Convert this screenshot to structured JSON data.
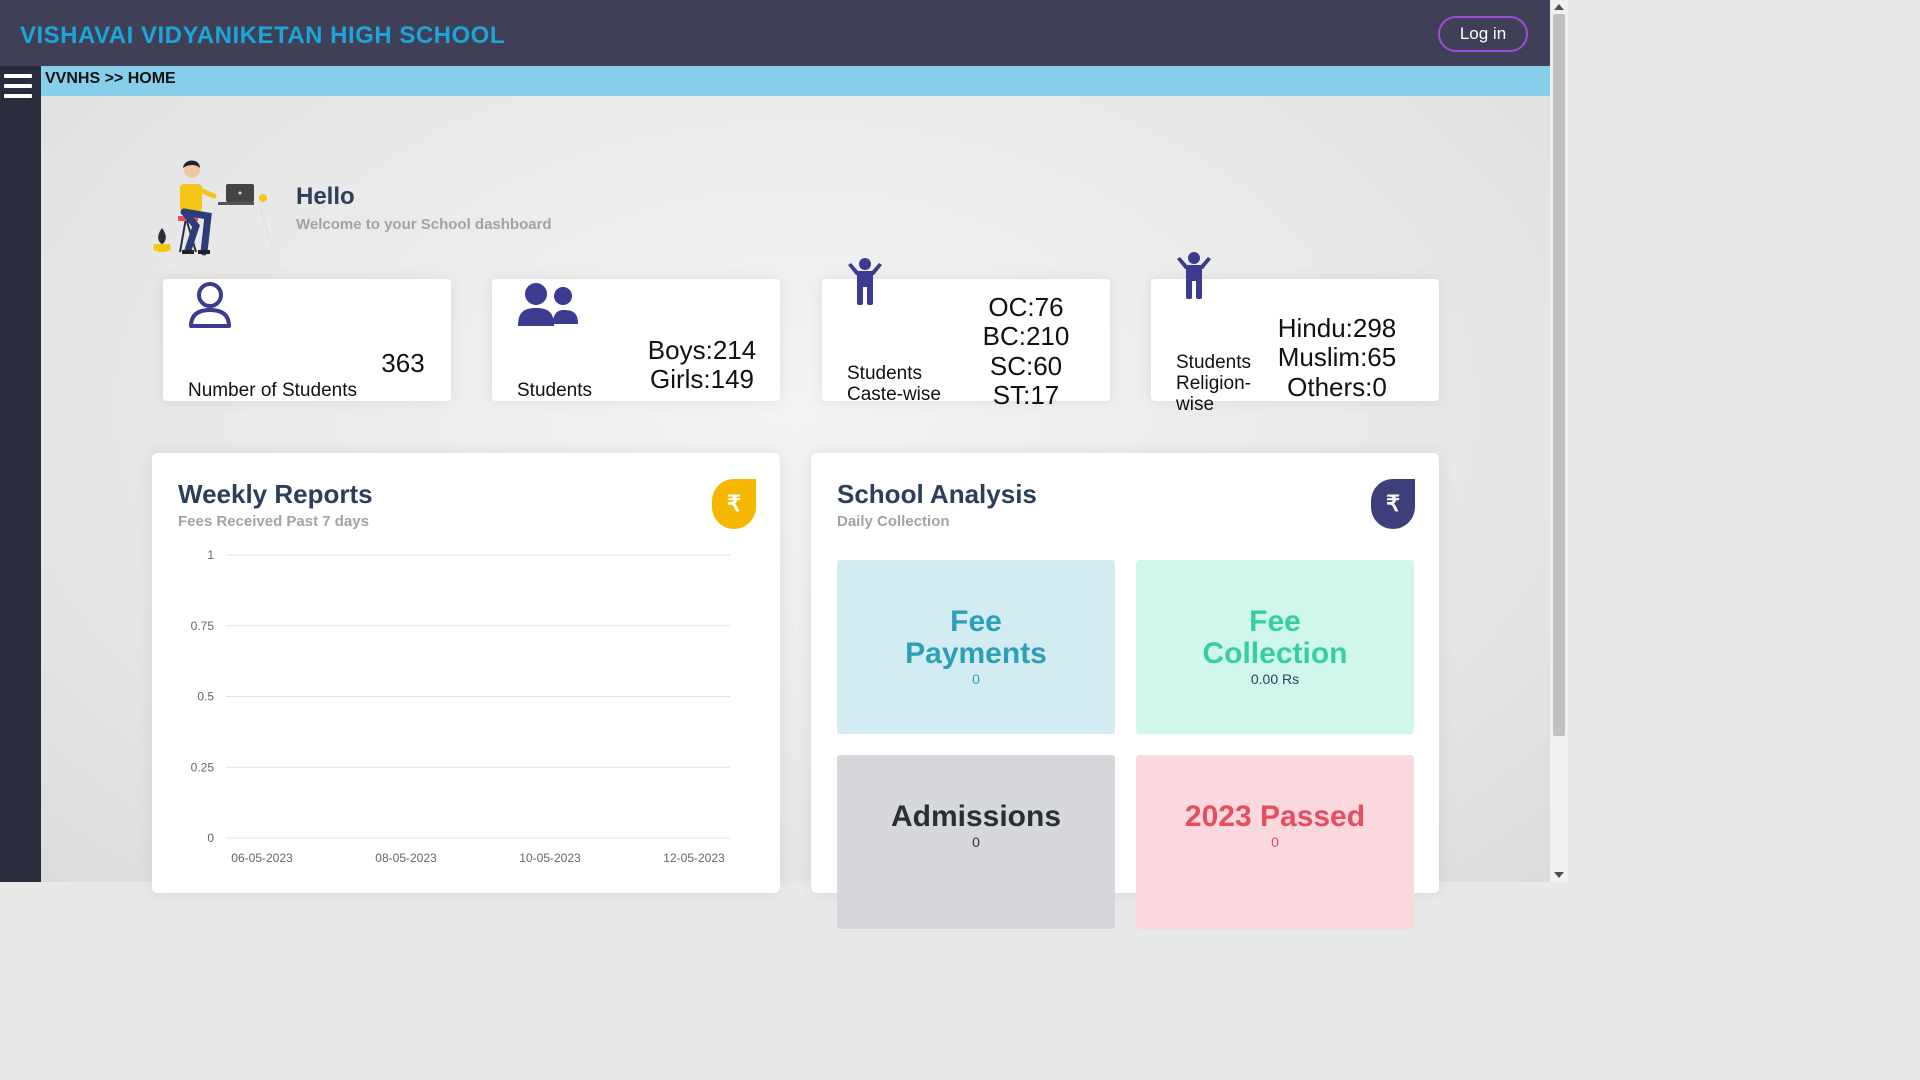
{
  "header": {
    "brand": "VISHAVAI VIDYANIKETAN HIGH SCHOOL",
    "login_label": "Log in"
  },
  "breadcrumb": "VVNHS >> HOME",
  "hello": {
    "title": "Hello",
    "subtitle": "Welcome to your School dashboard"
  },
  "stats": {
    "total": {
      "label": "Number of Students",
      "value": "363"
    },
    "gender": {
      "label": "Students",
      "boys": "Boys:214",
      "girls": "Girls:149"
    },
    "caste": {
      "label_line1": "Students",
      "label_line2": "Caste-wise",
      "oc": "OC:76",
      "bc": "BC:210",
      "sc": "SC:60",
      "st": "ST:17"
    },
    "religion": {
      "label_line1": "Students",
      "label_line2": "Religion-",
      "label_line3": "wise",
      "hindu": "Hindu:298",
      "muslim": "Muslim:65",
      "others": "Others:0"
    }
  },
  "weekly": {
    "title": "Weekly Reports",
    "subtitle": "Fees Received Past 7 days",
    "badge": "₹",
    "badge_color": "#f5b700"
  },
  "analysis": {
    "title": "School Analysis",
    "subtitle": "Daily Collection",
    "badge": "₹",
    "badge_color": "#3c3f7a",
    "tiles": [
      {
        "title_line1": "Fee",
        "title_line2": "Payments",
        "value": "0",
        "bg": "#d3ecf1",
        "color": "#2ba1b8",
        "value_color": "#2ba1b8"
      },
      {
        "title_line1": "Fee",
        "title_line2": "Collection",
        "value": "0.00 Rs",
        "bg": "#d0f7ec",
        "color": "#38cfa0",
        "value_color": "#2c3e5a"
      },
      {
        "title": "Admissions",
        "value": "0",
        "bg": "#d6d8db",
        "color": "#2b2f33",
        "value_color": "#2b2f33"
      },
      {
        "title": "2023 Passed",
        "value": "0",
        "bg": "#fbd8dd",
        "color": "#e64d5f",
        "value_color": "#e64d5f"
      }
    ]
  },
  "chart_data": {
    "type": "line",
    "title": "",
    "categories": [
      "06-05-2023",
      "08-05-2023",
      "10-05-2023",
      "12-05-2023"
    ],
    "y_ticks": [
      "1",
      "0.75",
      "0.5",
      "0.25",
      "0"
    ],
    "ylim": [
      0,
      1
    ],
    "series": [],
    "grid": true
  }
}
